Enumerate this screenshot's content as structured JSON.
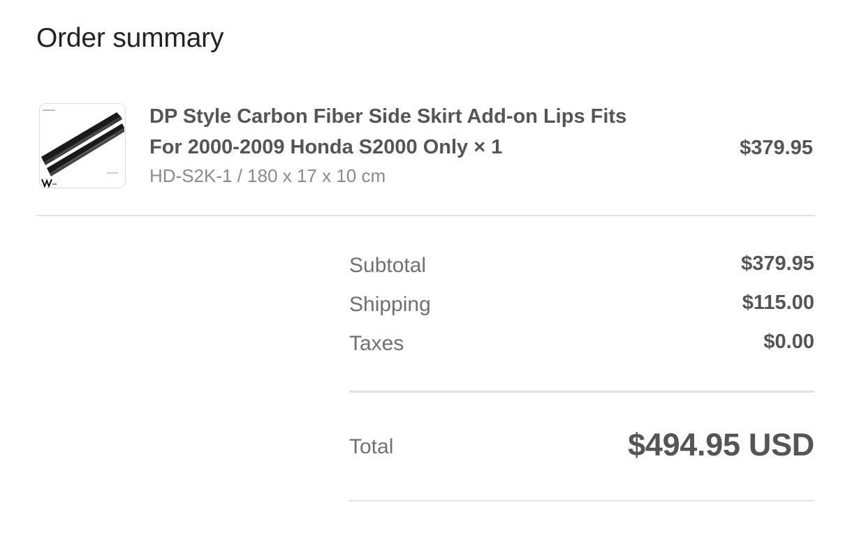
{
  "page_title": "Order summary",
  "line_item": {
    "title_line1": "DP Style Carbon Fiber Side Skirt Add-on Lips Fits",
    "title_line2": "For 2000-2009 Honda S2000 Only × 1",
    "variant": "HD-S2K-1 / 180 x 17 x 10 cm",
    "price": "$379.95",
    "thumbnail_icon": "side-skirt-product-image"
  },
  "totals": {
    "subtotal_label": "Subtotal",
    "subtotal_value": "$379.95",
    "shipping_label": "Shipping",
    "shipping_value": "$115.00",
    "taxes_label": "Taxes",
    "taxes_value": "$0.00",
    "total_label": "Total",
    "total_value": "$494.95 USD"
  },
  "colors": {
    "text_dark": "#555555",
    "text_muted": "#707070",
    "divider": "#e3e3e3"
  }
}
